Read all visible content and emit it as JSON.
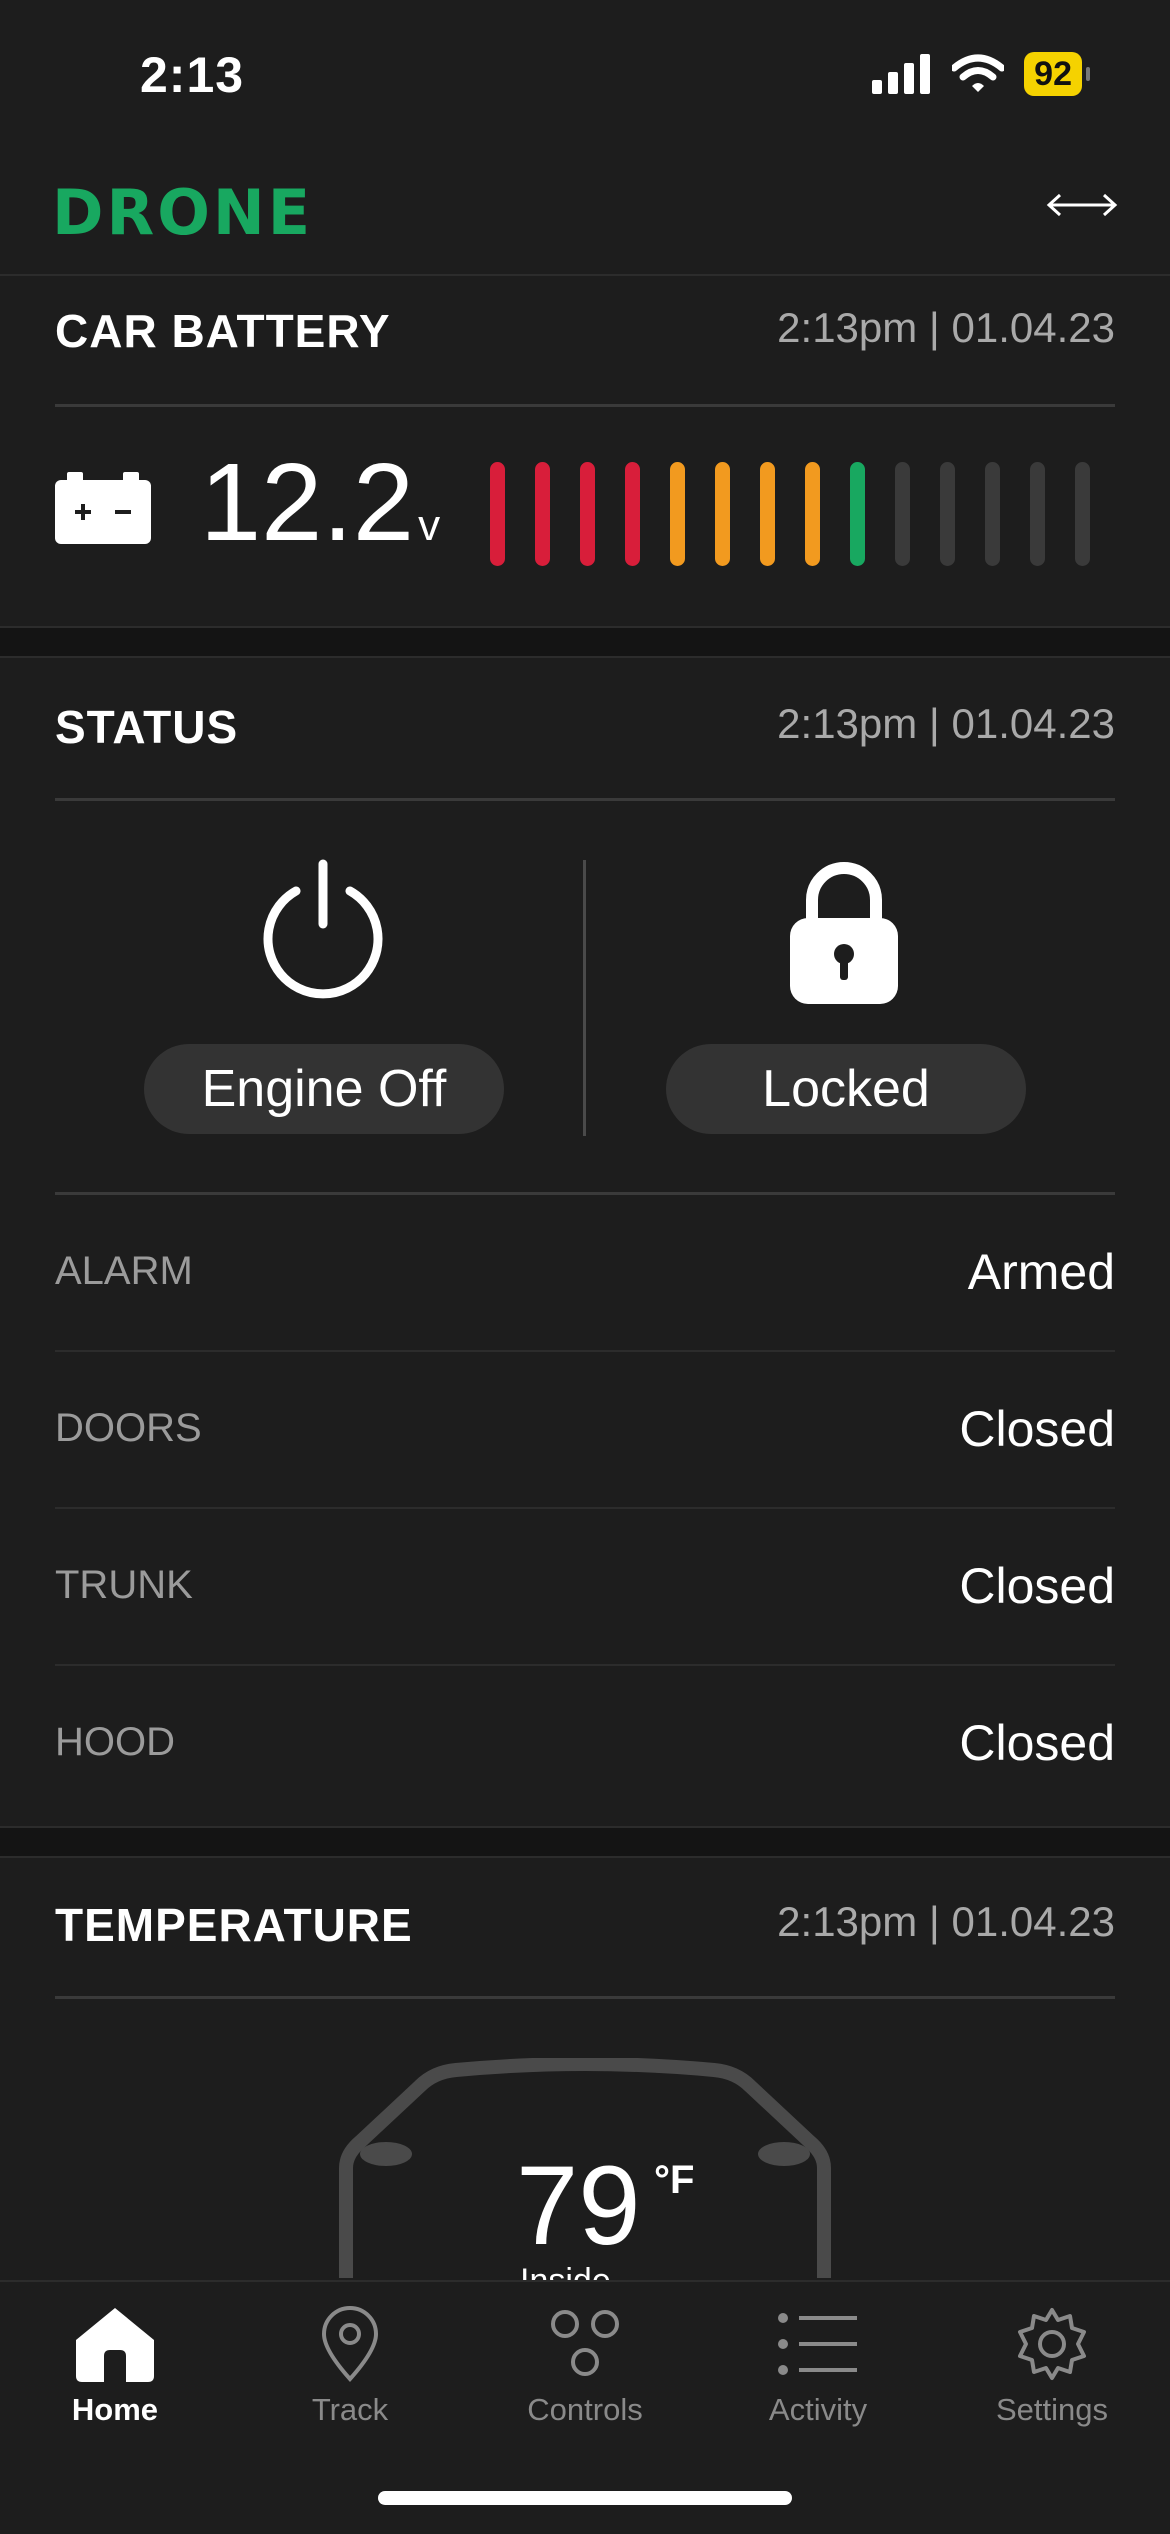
{
  "status_bar": {
    "time": "2:13",
    "battery": "92"
  },
  "app": {
    "logo": "DRONE",
    "swap_icon": "swap-horizontal-icon"
  },
  "battery_card": {
    "title": "CAR BATTERY",
    "timestamp": "2:13pm | 01.04.23",
    "voltage": "12.2",
    "unit": "v",
    "level_segments_lit": 9,
    "segment_colors": [
      "#d81e3a",
      "#d81e3a",
      "#d81e3a",
      "#d81e3a",
      "#f29a1f",
      "#f29a1f",
      "#f29a1f",
      "#f29a1f",
      "#18a860",
      "#3a3a3a",
      "#3a3a3a",
      "#3a3a3a",
      "#3a3a3a",
      "#3a3a3a"
    ]
  },
  "status_card": {
    "title": "STATUS",
    "timestamp": "2:13pm | 01.04.23",
    "engine_label": "Engine Off",
    "lock_label": "Locked",
    "rows": [
      {
        "label": "ALARM",
        "value": "Armed"
      },
      {
        "label": "DOORS",
        "value": "Closed"
      },
      {
        "label": "TRUNK",
        "value": "Closed"
      },
      {
        "label": "HOOD",
        "value": "Closed"
      }
    ]
  },
  "temperature_card": {
    "title": "TEMPERATURE",
    "timestamp": "2:13pm | 01.04.23",
    "value": "79",
    "unit": "°F",
    "sub_label": "Inside"
  },
  "tabs": [
    {
      "label": "Home",
      "icon": "home-icon",
      "active": true
    },
    {
      "label": "Track",
      "icon": "map-pin-icon",
      "active": false
    },
    {
      "label": "Controls",
      "icon": "controls-icon",
      "active": false
    },
    {
      "label": "Activity",
      "icon": "list-icon",
      "active": false
    },
    {
      "label": "Settings",
      "icon": "gear-icon",
      "active": false
    }
  ],
  "colors": {
    "accent": "#18a860",
    "background": "#1d1d1d",
    "battery_pill": "#f5d200"
  }
}
